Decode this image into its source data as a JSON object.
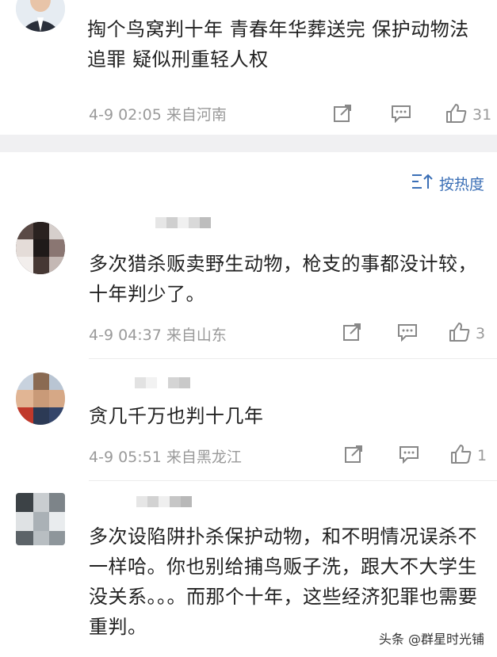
{
  "post": {
    "text": "掏个鸟窝判十年 青春年华葬送完 保护动物法追罪 疑似刑重轻人权",
    "meta": "4-9 02:05 来自河南",
    "like_count": "31"
  },
  "sort": {
    "label": "按热度"
  },
  "comments": [
    {
      "text": "多次猎杀贩卖野生动物，枪支的事都没计较，十年判少了。",
      "meta": "4-9 04:37 来自山东",
      "like_count": "3"
    },
    {
      "text": "贪几千万也判十几年",
      "meta": "4-9 05:51 来自黑龙江",
      "like_count": "1"
    },
    {
      "text": "多次设陷阱扑杀保护动物，和不明情况误杀不一样哈。你也别给捕鸟贩子洗，跟大不大学生没关系。。。而那个十年，这些经济犯罪也需要重判。"
    }
  ],
  "watermark": "头条 @群星时光铺",
  "icons": {
    "share": "share-icon",
    "comment": "comment-icon",
    "like": "thumbs-up-icon",
    "sort": "sort-icon"
  },
  "colors": {
    "link_blue": "#3b6fb6",
    "meta_gray": "#9a9a9a",
    "band": "#f0f0f2"
  }
}
